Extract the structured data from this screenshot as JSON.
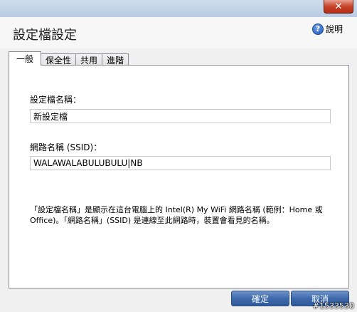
{
  "titlebar": {
    "close_symbol": "✕"
  },
  "dialog": {
    "title": "設定檔設定"
  },
  "help": {
    "icon": "help-icon",
    "symbol": "?",
    "label": "說明"
  },
  "tabs": [
    {
      "label": "一般",
      "active": true
    },
    {
      "label": "保全性",
      "active": false
    },
    {
      "label": "共用",
      "active": false
    },
    {
      "label": "進階",
      "active": false
    }
  ],
  "form": {
    "profile_name_label": "設定檔名稱：",
    "profile_name_value": "新設定檔",
    "ssid_label": "網路名稱 (SSID)：",
    "ssid_value": "WALAWALABULUBULU|NB"
  },
  "description": "「設定檔名稱」是顯示在這台電腦上的 Intel(R) My WiFi 網路名稱 (範例：Home 或 Office)。「網路名稱」(SSID) 是連線至此網路時，裝置會看見的名稱。",
  "buttons": {
    "ok": "確定",
    "cancel": "取消"
  },
  "watermark": "#1533530",
  "colors": {
    "button_blue": "#3e6aab",
    "close_red": "#c7432b"
  }
}
